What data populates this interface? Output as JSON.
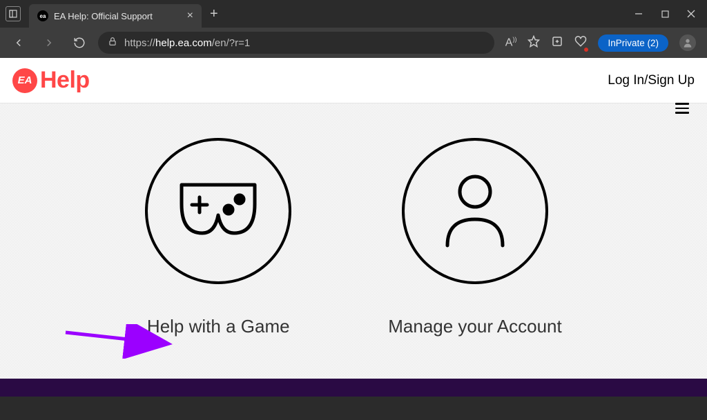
{
  "browser": {
    "tab_title": "EA Help: Official Support",
    "url_prefix": "https://",
    "url_host": "help.ea.com",
    "url_path": "/en/?r=1",
    "inprivate_label": "InPrivate (2)"
  },
  "site": {
    "logo_badge": "EA",
    "logo_text": "Help",
    "login_label": "Log In/Sign Up"
  },
  "options": {
    "game_help_label": "Help with a Game",
    "manage_account_label": "Manage your Account"
  }
}
